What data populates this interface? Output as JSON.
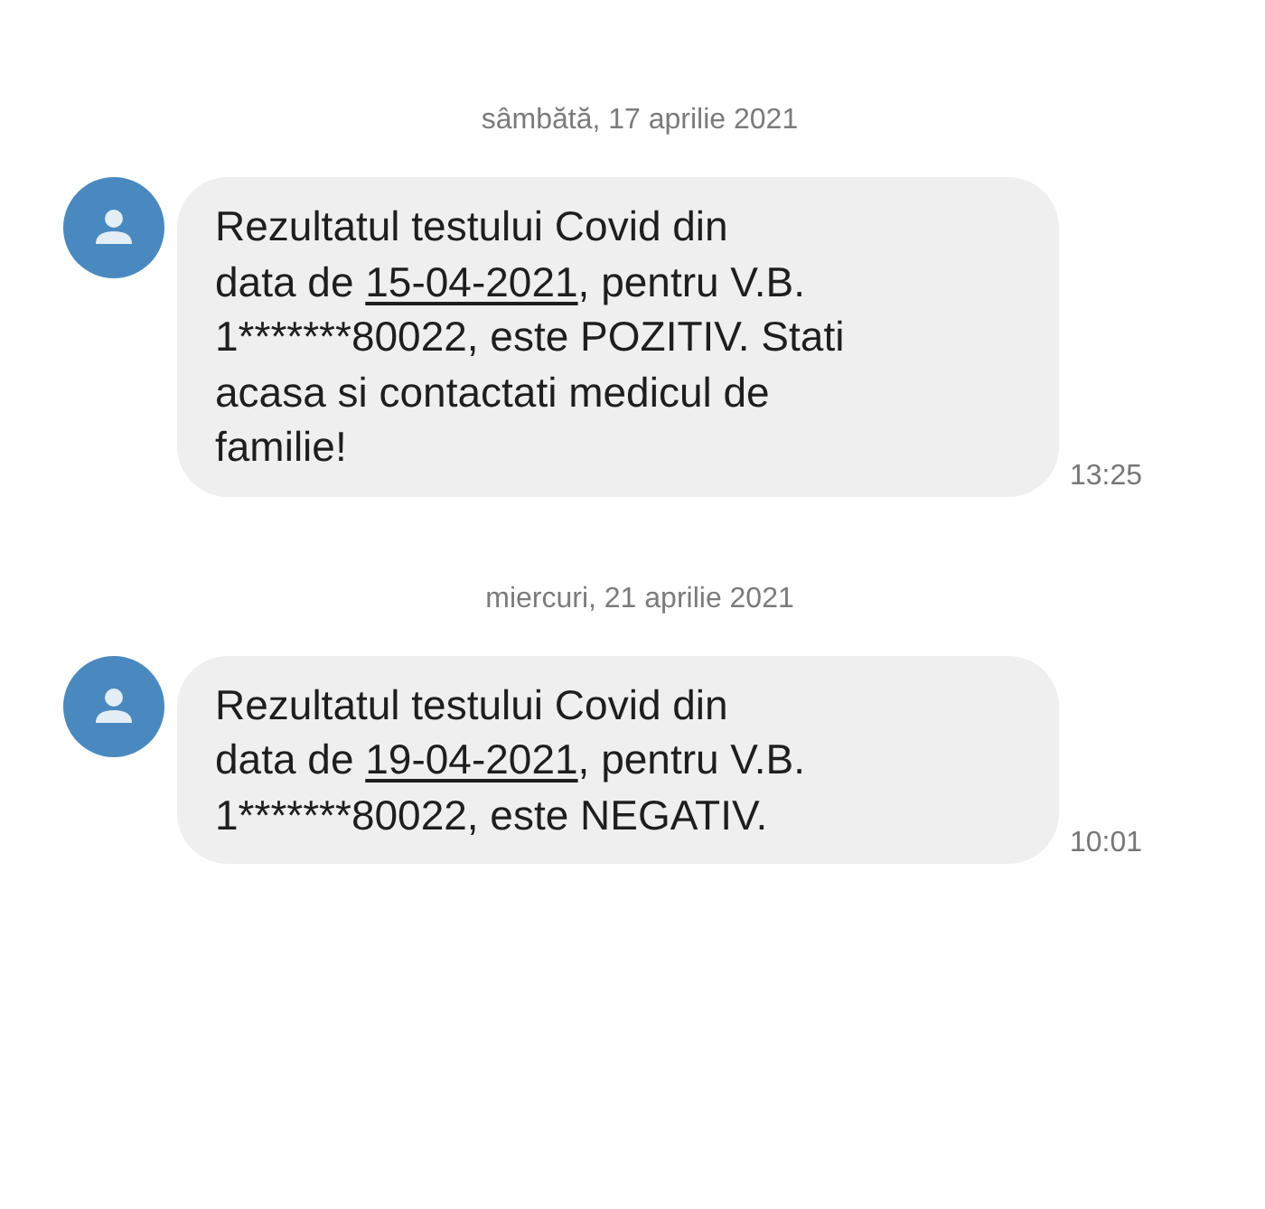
{
  "conversation": [
    {
      "date": "sâmbătă, 17 aprilie 2021",
      "time": "13:25",
      "lines": [
        [
          {
            "text": "Rezultatul testului Covid din"
          }
        ],
        [
          {
            "text": "data de "
          },
          {
            "text": "15-04-2021",
            "link": true
          },
          {
            "text": ", pentru V.B."
          }
        ],
        [
          {
            "text": "1*******80022, este POZITIV. Stati"
          }
        ],
        [
          {
            "text": "acasa si contactati medicul de"
          }
        ],
        [
          {
            "text": "familie!"
          }
        ]
      ]
    },
    {
      "date": "miercuri, 21 aprilie 2021",
      "time": "10:01",
      "lines": [
        [
          {
            "text": "Rezultatul testului Covid din"
          }
        ],
        [
          {
            "text": "data de "
          },
          {
            "text": "19-04-2021",
            "link": true
          },
          {
            "text": ", pentru V.B."
          }
        ],
        [
          {
            "text": "1*******80022, este NEGATIV."
          }
        ]
      ]
    }
  ]
}
